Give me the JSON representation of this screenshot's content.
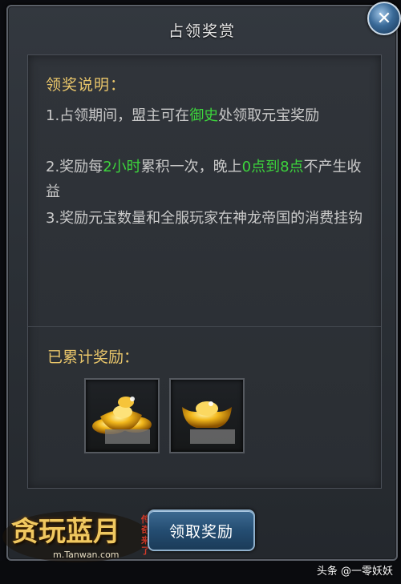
{
  "dialog": {
    "title": "占领奖赏",
    "close_label": "✕"
  },
  "rules": {
    "heading": "领奖说明：",
    "line1_a": "1.占领期间，盟主可在",
    "line1_hl": "御史",
    "line1_b": "处领取元宝奖励",
    "line2_a": "2.奖励每",
    "line2_hl1": "2小时",
    "line2_b": "累积一次，晚上",
    "line2_hl2": "0点到8点",
    "line2_c": "不产生收益",
    "line3": "3.奖励元宝数量和全服玩家在神龙帝国的消费挂钩"
  },
  "rewards": {
    "heading": "已累计奖励：",
    "slots": [
      {
        "icon": "gold-ingot-pile-icon"
      },
      {
        "icon": "gold-ingot-icon"
      }
    ]
  },
  "claim_button": {
    "label": "领取奖励"
  },
  "logo": {
    "title": "贪玩蓝月",
    "sub": "传奇来了",
    "url": "m.Tanwan.com"
  },
  "watermark": "头条 @一零妖妖",
  "colors": {
    "heading": "#e8c56a",
    "highlight": "#3cd53c",
    "body_text": "#c9c9c9"
  }
}
